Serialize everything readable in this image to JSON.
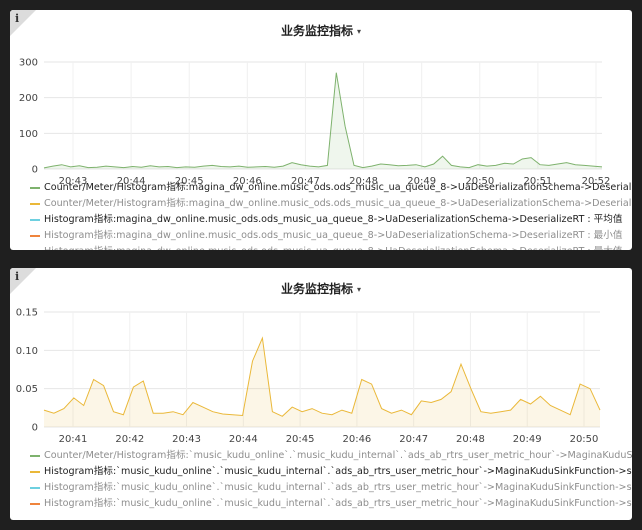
{
  "panels": [
    {
      "info": "i",
      "title": "业务监控指标",
      "chevron": "▾",
      "chart_data": {
        "type": "area",
        "x_ticks": [
          "20:43",
          "20:44",
          "20:45",
          "20:46",
          "20:47",
          "20:48",
          "20:49",
          "20:50",
          "20:51",
          "20:52"
        ],
        "ylim": [
          0,
          300
        ],
        "y_ticks": [
          "0",
          "100",
          "200",
          "300"
        ],
        "grid": true,
        "series": [
          {
            "name": "Counter/Meter/Histogram指标:magina_dw_online.music_ods.ods_music_ua_queue_8->UaDeserializationSchema->DeserializeError : sum",
            "color": "#7eb26d",
            "values": [
              3,
              8,
              12,
              6,
              9,
              4,
              5,
              8,
              6,
              4,
              7,
              5,
              9,
              6,
              7,
              4,
              6,
              5,
              8,
              10,
              7,
              6,
              8,
              5,
              6,
              7,
              5,
              8,
              18,
              12,
              8,
              6,
              10,
              270,
              120,
              10,
              4,
              8,
              14,
              12,
              9,
              10,
              12,
              6,
              14,
              36,
              10,
              6,
              4,
              12,
              8,
              10,
              16,
              14,
              28,
              32,
              12,
              10,
              14,
              18,
              12,
              10,
              8,
              6
            ]
          }
        ],
        "legend": [
          {
            "label": "Counter/Meter/Histogram指标:magina_dw_online.music_ods.ods_music_ua_queue_8->UaDeserializationSchema->DeserializeError : sum",
            "color": "#7eb26d",
            "style": "strong"
          },
          {
            "label": "Counter/Meter/Histogram指标:magina_dw_online.music_ods.ods_music_ua_queue_8->UaDeserializationSchema->DeserializeRT : sum",
            "color": "#eab839",
            "style": "muted"
          },
          {
            "label": "Histogram指标:magina_dw_online.music_ods.ods_music_ua_queue_8->UaDeserializationSchema->DeserializeRT : 平均值",
            "color": "#6ed0e0",
            "style": "strong"
          },
          {
            "label": "Histogram指标:magina_dw_online.music_ods.ods_music_ua_queue_8->UaDeserializationSchema->DeserializeRT : 最小值",
            "color": "#ef843c",
            "style": "muted"
          },
          {
            "label": "Histogram指标:magina_dw_online.music_ods.ods_music_ua_queue_8->UaDeserializationSchema->DeserializeRT : 最大值",
            "color": "#e24d42",
            "style": "muted"
          }
        ]
      }
    },
    {
      "info": "i",
      "title": "业务监控指标",
      "chevron": "▾",
      "chart_data": {
        "type": "area",
        "x_ticks": [
          "20:41",
          "20:42",
          "20:43",
          "20:44",
          "20:45",
          "20:46",
          "20:47",
          "20:48",
          "20:49",
          "20:50"
        ],
        "ylim": [
          0,
          0.15
        ],
        "y_ticks": [
          "0",
          "0.05",
          "0.10",
          "0.15"
        ],
        "grid": true,
        "series": [
          {
            "name": "Histogram指标:`music_kudu_online`.`music_kudu_internal`.`ads_ab_rtrs_user_metric_hour`->MaginaKuduSinkFunction->sinkRT : 平均值",
            "color": "#eab839",
            "values": [
              0.022,
              0.018,
              0.024,
              0.038,
              0.028,
              0.062,
              0.054,
              0.02,
              0.016,
              0.052,
              0.06,
              0.018,
              0.018,
              0.02,
              0.016,
              0.032,
              0.026,
              0.02,
              0.017,
              0.016,
              0.015,
              0.086,
              0.116,
              0.02,
              0.014,
              0.026,
              0.02,
              0.024,
              0.018,
              0.016,
              0.022,
              0.018,
              0.062,
              0.056,
              0.024,
              0.018,
              0.022,
              0.016,
              0.034,
              0.032,
              0.036,
              0.046,
              0.082,
              0.05,
              0.02,
              0.018,
              0.02,
              0.022,
              0.036,
              0.03,
              0.04,
              0.028,
              0.022,
              0.016,
              0.056,
              0.05,
              0.022
            ]
          }
        ],
        "legend": [
          {
            "label": "Counter/Meter/Histogram指标:`music_kudu_online`.`music_kudu_internal`.`ads_ab_rtrs_user_metric_hour`->MaginaKuduSinkFunction->sinkRT : sum",
            "color": "#7eb26d",
            "style": "muted"
          },
          {
            "label": "Histogram指标:`music_kudu_online`.`music_kudu_internal`.`ads_ab_rtrs_user_metric_hour`->MaginaKuduSinkFunction->sinkRT : 平均值",
            "color": "#eab839",
            "style": "strong"
          },
          {
            "label": "Histogram指标:`music_kudu_online`.`music_kudu_internal`.`ads_ab_rtrs_user_metric_hour`->MaginaKuduSinkFunction->sinkRT : 最小值",
            "color": "#6ed0e0",
            "style": "muted"
          },
          {
            "label": "Histogram指标:`music_kudu_online`.`music_kudu_internal`.`ads_ab_rtrs_user_metric_hour`->MaginaKuduSinkFunction->sinkRT : 最大值",
            "color": "#ef843c",
            "style": "muted"
          }
        ]
      }
    }
  ]
}
